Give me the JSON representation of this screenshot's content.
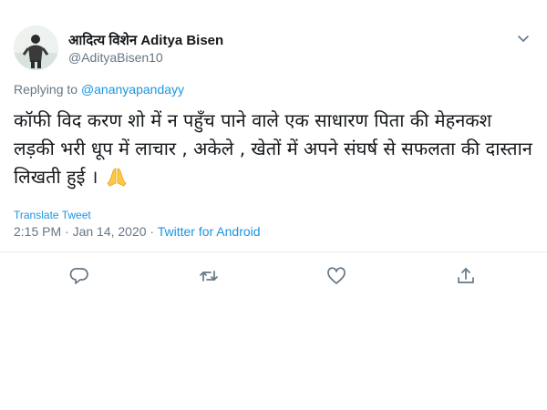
{
  "user": {
    "display_name": "आदित्य विशेन Aditya Bisen",
    "handle": "@AdityaBisen10"
  },
  "reply": {
    "prefix": "Replying to ",
    "to_handle": "@ananyapandayy"
  },
  "tweet": {
    "text": "कॉफी विद करण शो में न पहुँच पाने वाले एक साधारण पिता की मेहनकश लड़की भरी धूप में लाचार , अकेले , खेतों में अपने संघर्ष से सफलता की दास्तान लिखती हुई ।",
    "emoji": "folded-hands-emoji",
    "translate_label": "Translate Tweet",
    "timestamp": "2:15 PM · Jan 14, 2020 · ",
    "source": "Twitter for Android"
  },
  "actions": {
    "icons": [
      "reply-icon",
      "retweet-icon",
      "like-icon",
      "share-icon"
    ]
  },
  "colors": {
    "link": "#1b95e0",
    "secondary_text": "#657786",
    "primary_text": "#14171a",
    "divider": "#e6ecf0"
  }
}
